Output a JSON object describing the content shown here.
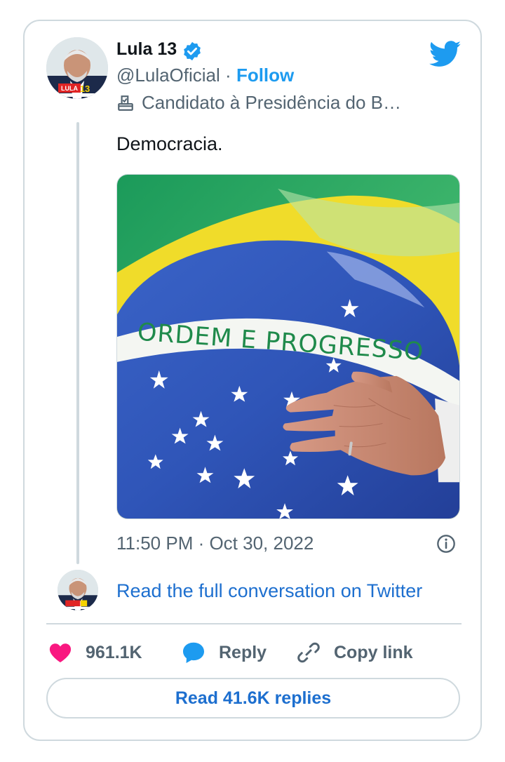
{
  "author": {
    "display_name": "Lula 13",
    "handle": "@LulaOficial",
    "separator": "·",
    "follow_label": "Follow",
    "bio": "Candidato à Presidência do B…",
    "avatar_badge": "LULA",
    "avatar_badge_number": "13"
  },
  "tweet": {
    "text": "Democracia.",
    "timestamp": "11:50 PM · Oct 30, 2022",
    "media_banner_text": "ORDEM E PROGRESSO"
  },
  "conversation": {
    "read_full_label": "Read the full conversation on Twitter"
  },
  "actions": {
    "likes": "961.1K",
    "reply_label": "Reply",
    "copy_link_label": "Copy link"
  },
  "footer": {
    "read_replies_label": "Read 41.6K replies"
  },
  "colors": {
    "accent": "#1d9bf0",
    "link": "#1d6fcf",
    "heart": "#f91880",
    "muted": "#536471",
    "border": "#cfd9de"
  },
  "icons": [
    "verified-badge-icon",
    "twitter-bird-icon",
    "ballot-box-icon",
    "info-icon",
    "heart-icon",
    "reply-bubble-icon",
    "link-icon"
  ]
}
